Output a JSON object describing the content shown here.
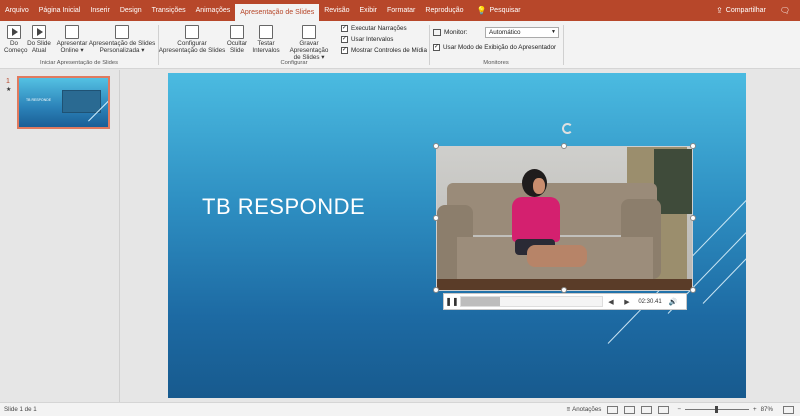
{
  "menubar": {
    "tabs": [
      "Arquivo",
      "Página Inicial",
      "Inserir",
      "Design",
      "Transições",
      "Animações",
      "Apresentação de Slides",
      "Revisão",
      "Exibir",
      "Formatar",
      "Reprodução"
    ],
    "active_tab": "Apresentação de Slides",
    "search_label": "Pesquisar",
    "share_label": "Compartilhar"
  },
  "ribbon": {
    "from_beginning": [
      "Do",
      "Começo"
    ],
    "from_current": [
      "Do Slide",
      "Atual"
    ],
    "online": [
      "Apresentar",
      "Online ▾"
    ],
    "custom": [
      "Apresentação de Slides",
      "Personalizada ▾"
    ],
    "group_start": "Iniciar Apresentação de Slides",
    "setup": [
      "Configurar",
      "Apresentação de Slides"
    ],
    "hide_slide": [
      "Ocultar",
      "Slide"
    ],
    "rehearse": [
      "Testar",
      "Intervalos"
    ],
    "record": [
      "Gravar Apresentação",
      "de Slides ▾"
    ],
    "checkboxes": [
      {
        "label": "Executar Narrações",
        "checked": true
      },
      {
        "label": "Usar Intervalos",
        "checked": true
      },
      {
        "label": "Mostrar Controles de Mídia",
        "checked": true
      }
    ],
    "group_setup": "Configurar",
    "monitor_label": "Monitor:",
    "monitor_value": "Automático",
    "presenter_view_label": "Usar Modo de Exibição do Apresentador",
    "presenter_view_checked": true,
    "group_monitors": "Monitores"
  },
  "thumbnail": {
    "number": "1",
    "star": "★",
    "title": "TB RESPONDE"
  },
  "slide": {
    "title": "TB RESPONDE"
  },
  "video_controls": {
    "time": "02:30.41",
    "progress": 0.28
  },
  "statusbar": {
    "slide_info": "Slide 1 de 1",
    "notes_label": "Anotações",
    "zoom_minus": "−",
    "zoom_plus": "+",
    "zoom_percent": "87%",
    "zoom_fraction": 0.5
  }
}
